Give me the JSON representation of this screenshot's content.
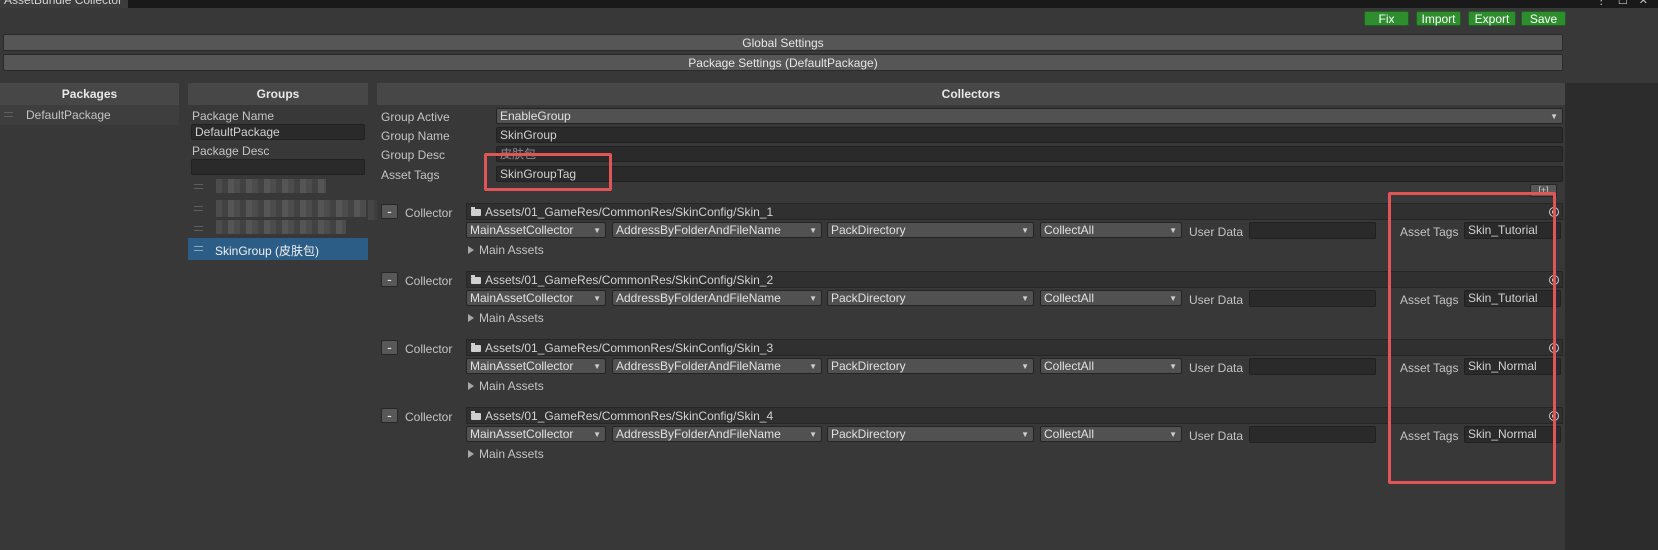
{
  "window": {
    "title": "AssetBundle Collector"
  },
  "toolbar": {
    "fix": "Fix",
    "import": "Import",
    "export": "Export",
    "save": "Save"
  },
  "foldouts": {
    "global": "Global Settings",
    "package": "Package Settings (DefaultPackage)"
  },
  "packages": {
    "header": "Packages",
    "items": [
      "DefaultPackage"
    ]
  },
  "groups": {
    "header": "Groups",
    "package_name_label": "Package Name",
    "package_name_value": "DefaultPackage",
    "package_desc_label": "Package Desc",
    "package_desc_value": "",
    "selected_item": "SkinGroup (皮肤包)"
  },
  "collectors_panel": {
    "header": "Collectors",
    "group_active_label": "Group Active",
    "group_active_value": "EnableGroup",
    "group_name_label": "Group Name",
    "group_name_value": "SkinGroup",
    "group_desc_label": "Group Desc",
    "group_desc_value": "皮肤包",
    "asset_tags_label": "Asset Tags",
    "asset_tags_value": "SkinGroupTag"
  },
  "collector_rows": [
    {
      "label": "Collector",
      "path": "Assets/01_GameRes/CommonRes/SkinConfig/Skin_1",
      "type": "MainAssetCollector",
      "address": "AddressByFolderAndFileName",
      "pack": "PackDirectory",
      "filter": "CollectAll",
      "user_data_label": "User Data",
      "user_data": "",
      "tags_label": "Asset Tags",
      "tags": "Skin_Tutorial",
      "main_assets": "Main Assets"
    },
    {
      "label": "Collector",
      "path": "Assets/01_GameRes/CommonRes/SkinConfig/Skin_2",
      "type": "MainAssetCollector",
      "address": "AddressByFolderAndFileName",
      "pack": "PackDirectory",
      "filter": "CollectAll",
      "user_data_label": "User Data",
      "user_data": "",
      "tags_label": "Asset Tags",
      "tags": "Skin_Tutorial",
      "main_assets": "Main Assets"
    },
    {
      "label": "Collector",
      "path": "Assets/01_GameRes/CommonRes/SkinConfig/Skin_3",
      "type": "MainAssetCollector",
      "address": "AddressByFolderAndFileName",
      "pack": "PackDirectory",
      "filter": "CollectAll",
      "user_data_label": "User Data",
      "user_data": "",
      "tags_label": "Asset Tags",
      "tags": "Skin_Normal",
      "main_assets": "Main Assets"
    },
    {
      "label": "Collector",
      "path": "Assets/01_GameRes/CommonRes/SkinConfig/Skin_4",
      "type": "MainAssetCollector",
      "address": "AddressByFolderAndFileName",
      "pack": "PackDirectory",
      "filter": "CollectAll",
      "user_data_label": "User Data",
      "user_data": "",
      "tags_label": "Asset Tags",
      "tags": "Skin_Normal",
      "main_assets": "Main Assets"
    }
  ],
  "minus_label": "-",
  "colors": {
    "accent_green": "#2e8e2e",
    "selected_blue": "#2c5d87",
    "highlight_red": "#e05555"
  }
}
